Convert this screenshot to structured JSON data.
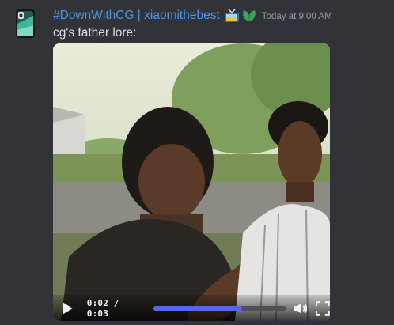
{
  "message": {
    "username": "#DownWithCG | xiaomithebest",
    "timestamp": "Today at 9:00 AM",
    "content": "cg's father lore:",
    "avatar_icon": "phone-avatar-icon",
    "badges": [
      "tv-badge-icon",
      "leaf-badge-icon"
    ]
  },
  "video": {
    "time_display": "0:02 / 0:03",
    "progress": 0.67,
    "accent_color": "#5865f2"
  }
}
